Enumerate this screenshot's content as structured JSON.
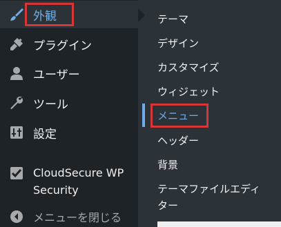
{
  "menu": {
    "items": [
      {
        "label": "外観",
        "icon": "paintbrush-icon",
        "active": true
      },
      {
        "label": "プラグイン",
        "icon": "plugin-icon"
      },
      {
        "label": "ユーザー",
        "icon": "user-icon"
      },
      {
        "label": "ツール",
        "icon": "wrench-icon"
      },
      {
        "label": "設定",
        "icon": "settings-icon"
      },
      {
        "label": "CloudSecure WP Security",
        "icon": "shield-check-icon"
      }
    ],
    "collapse_label": "メニューを閉じる"
  },
  "submenu": {
    "items": [
      {
        "label": "テーマ"
      },
      {
        "label": "デザイン"
      },
      {
        "label": "カスタマイズ"
      },
      {
        "label": "ウィジェット"
      },
      {
        "label": "メニュー",
        "current": true
      },
      {
        "label": "ヘッダー"
      },
      {
        "label": "背景"
      },
      {
        "label": "テーマファイルエディター"
      }
    ]
  },
  "colors": {
    "sidebar_bg": "#1d2327",
    "submenu_bg": "#2c3338",
    "accent": "#72aee6",
    "highlight": "#d63638"
  }
}
